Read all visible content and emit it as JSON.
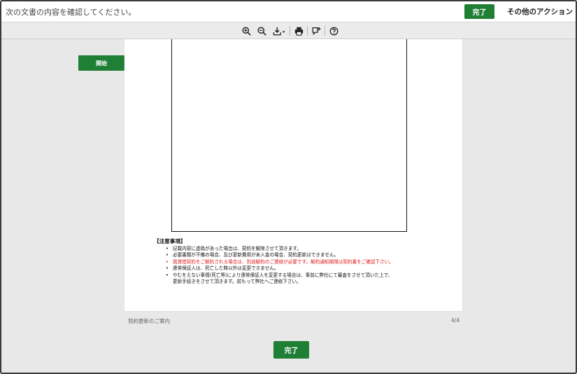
{
  "header": {
    "instruction": "次の文書の内容を確認してください。",
    "finish_label": "完了",
    "other_actions_label": "その他のアクション"
  },
  "toolbar": {
    "icons": [
      "zoom-in-icon",
      "zoom-out-icon",
      "download-icon",
      "print-icon",
      "comment-icon",
      "help-icon"
    ]
  },
  "document": {
    "notes_title": "【注意事項】",
    "notes": [
      {
        "lines": [
          "記載内容に虚偽があった場合は、契約を解除させて頂きます。"
        ],
        "highlight": false
      },
      {
        "lines": [
          "必要書類が不備の場合、及び更新費用が未入金の場合、契約更新はできません。"
        ],
        "highlight": false
      },
      {
        "lines": [
          "賃貸借契約をご解約される場合は、別途解約のご連絡が必要です。解約通知期限は契約書をご確認下さい。"
        ],
        "highlight": true
      },
      {
        "lines": [
          "連帯保証人は、死亡した時以外は変更できません。"
        ],
        "highlight": false
      },
      {
        "lines": [
          "やむをえない事情(死亡等)により連帯保証人を変更する場合は、事前に弊社にて審査をさせて頂いた上で、",
          "更新手続きをさせて頂きます。前もって弊社へご連絡下さい。"
        ],
        "highlight": false
      }
    ],
    "doc_name": "契約更新のご案内",
    "page_indicator": "4/4"
  },
  "start_label": "開始",
  "footer": {
    "finish_label": "完了"
  },
  "colors": {
    "accent_green": "#1f7f35",
    "warning_red": "#e01b1b"
  }
}
